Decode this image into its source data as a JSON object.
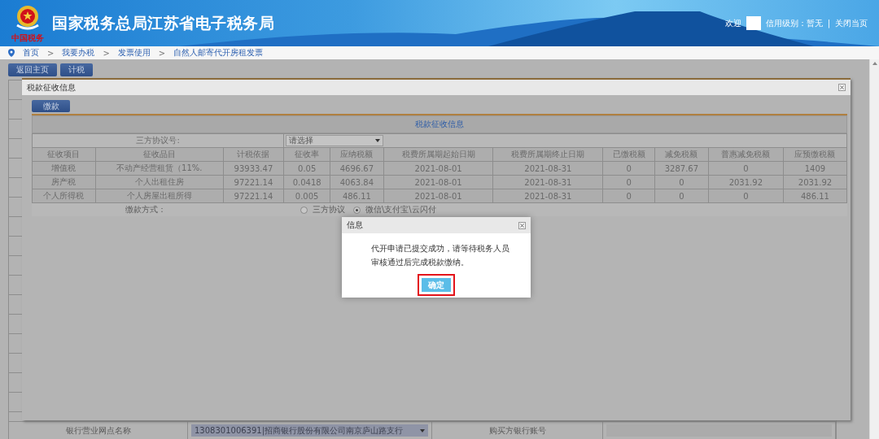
{
  "header": {
    "logo_text": "中国税务",
    "title": "国家税务总局江苏省电子税务局",
    "welcome": "欢迎",
    "credit": "信用级别：暂无",
    "separator": "|",
    "close": "关闭当页"
  },
  "breadcrumb": [
    {
      "label": "首页"
    },
    {
      "separator": ">",
      "label": "我要办税"
    },
    {
      "separator": ">",
      "label": "发票使用"
    },
    {
      "separator": ">",
      "label": "自然人邮寄代开房租发票"
    }
  ],
  "toolbar": [
    "返回主页",
    "计税"
  ],
  "panel": {
    "title": "税款征收信息",
    "pay_button": "缴款",
    "section_title": "税款征收信息",
    "agreement_label": "三方协议号:",
    "agreement_select": "请选择",
    "columns": [
      "征收项目",
      "征收品目",
      "计税依据",
      "征收率",
      "应纳税额",
      "税费所属期起始日期",
      "税费所属期终止日期",
      "已缴税额",
      "减免税额",
      "普惠减免税额",
      "应预缴税额"
    ],
    "rows": [
      [
        "增值税",
        "不动产经营租赁（11%.",
        "93933.47",
        "0.05",
        "4696.67",
        "2021-08-01",
        "2021-08-31",
        "0",
        "3287.67",
        "0",
        "1409"
      ],
      [
        "房产税",
        "个人出租住房",
        "97221.14",
        "0.0418",
        "4063.84",
        "2021-08-01",
        "2021-08-31",
        "0",
        "0",
        "2031.92",
        "2031.92"
      ],
      [
        "个人所得税",
        "个人房屋出租所得",
        "97221.14",
        "0.005",
        "486.11",
        "2021-08-01",
        "2021-08-31",
        "0",
        "0",
        "0",
        "486.11"
      ]
    ],
    "payment_label": "缴款方式：",
    "payment_options": [
      {
        "label": "三方协议",
        "selected": false
      },
      {
        "label": "微信\\支付宝\\云闪付",
        "selected": true
      }
    ]
  },
  "form_row": {
    "bank_branch_label": "银行营业网点名称",
    "bank_branch_value": "1308301006391|招商银行股份有限公司南京庐山路支行",
    "buyer_account_label": "购买方银行账号"
  },
  "message": {
    "title": "信息",
    "text": "代开申请已提交成功，请等待税务人员审核通过后完成税款缴纳。",
    "ok": "确定"
  }
}
